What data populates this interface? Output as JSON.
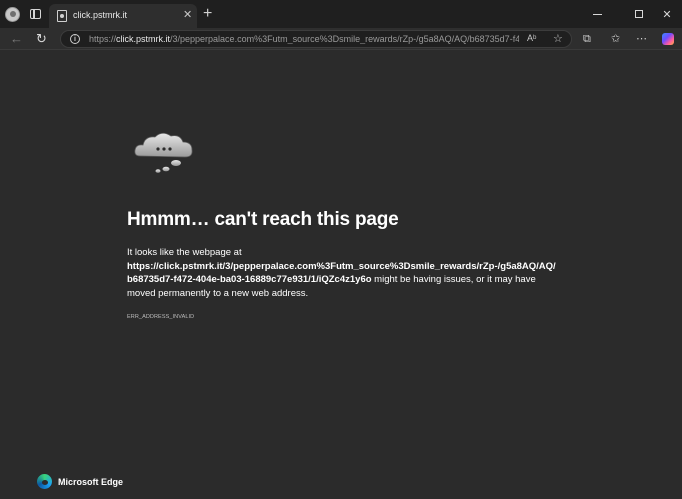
{
  "tab": {
    "title": "click.pstmrk.it",
    "close_glyph": "✕",
    "new_tab_glyph": "+"
  },
  "window": {
    "minimize_label": "",
    "maximize_label": "",
    "close_glyph": "✕"
  },
  "toolbar": {
    "back_glyph": "←",
    "refresh_glyph": "↻",
    "url_scheme": "https://",
    "url_host": "click.pstmrk.it",
    "url_rest": "/3/pepperpalace.com%3Futm_source%3Dsmile_rewards/rZp-/g5a8AQ/AQ/b68735d7-f472-...",
    "read_aloud_glyph": "Aᵇ",
    "favorite_glyph": "☆",
    "extensions_glyph": "⧉",
    "favorites_bar_glyph": "✩",
    "more_glyph": "⋯",
    "info_glyph": "i"
  },
  "error": {
    "headline": "Hmmm… can't reach this page",
    "intro": "It looks like the webpage at",
    "url": "https://click.pstmrk.it/3/pepperpalace.com%3Futm_source%3Dsmile_rewards/rZp-/g5a8AQ/AQ/b68735d7-f472-404e-ba03-16889c77e931/1/iQZc4z1y6o",
    "suffix": " might be having issues, or it may have moved permanently to a new web address.",
    "code": "ERR_ADDRESS_INVALID"
  },
  "brand": {
    "name": "Microsoft Edge"
  },
  "colors": {
    "background": "#2b2b2b",
    "titlebar": "#1f1f1f",
    "text": "#ffffff"
  }
}
